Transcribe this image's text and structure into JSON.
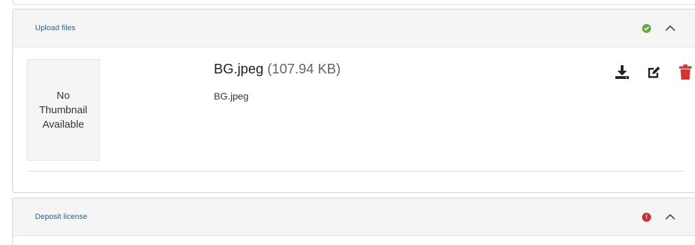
{
  "upload_panel": {
    "title": "Upload files",
    "status": "ok",
    "files": [
      {
        "thumbnail_text": "No Thumbnail Available",
        "name": "BG.jpeg",
        "size": "(107.94 KB)",
        "description": "BG.jpeg"
      }
    ]
  },
  "deposit_panel": {
    "title": "Deposit license",
    "status": "error",
    "status_glyph": "!"
  },
  "icons": {
    "ok": "check-circle-icon",
    "error": "exclamation-circle-icon",
    "collapse": "chevron-up-icon",
    "download": "download-icon",
    "edit": "edit-icon",
    "delete": "trash-icon"
  },
  "colors": {
    "title_blue": "#2b5c8a",
    "ok_green": "#6aa842",
    "error_red": "#c9302c",
    "delete_red": "#d9342b",
    "icon_dark": "#222222"
  }
}
